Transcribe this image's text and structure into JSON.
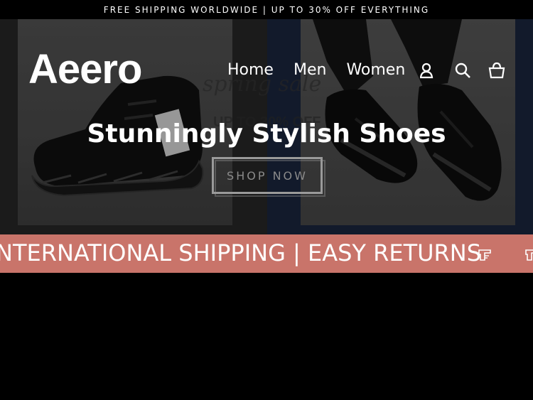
{
  "announcement": {
    "text": "FREE SHIPPING WORLDWIDE | UP TO 30% OFF EVERYTHING"
  },
  "header": {
    "logo": "Aeero",
    "nav": [
      {
        "label": "Home"
      },
      {
        "label": "Men"
      },
      {
        "label": "Women"
      }
    ],
    "icons": [
      "account-icon",
      "search-icon",
      "cart-icon"
    ]
  },
  "hero": {
    "background_text": "spring sale",
    "background_subtext": "UP TO 30% OFF",
    "headline": "Stunningly Stylish Shoes",
    "cta_label": "SHOP NOW"
  },
  "marquee": {
    "text": "NTERNATIONAL SHIPPING | EASY RETURNS",
    "icon": "pointing-hand-icon"
  },
  "colors": {
    "marquee_bg": "#c9746a",
    "text": "#ffffff",
    "background": "#000000"
  }
}
